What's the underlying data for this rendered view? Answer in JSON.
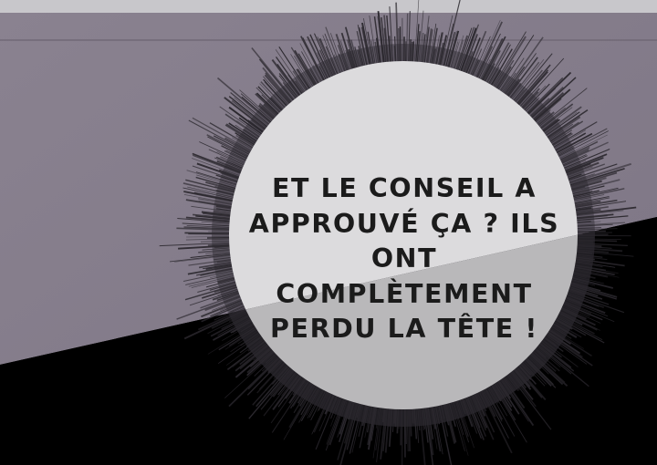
{
  "panel": {
    "colors": {
      "sky_wall": "#857d8b",
      "top_strip": "#c8c7cb",
      "dark_floor": "#000000",
      "bubble_fill": "#dcdbdd",
      "bubble_shadow_fill": "#b7b6b8",
      "spike_color": "#2b282e",
      "text_color": "#1b1b1b"
    },
    "speech_bubble": {
      "text": "ET LE CONSEIL A\nAPPROUVÉ ÇA ? ILS\nONT COMPLÈTEMENT\nPERDU LA TÊTE !"
    }
  }
}
